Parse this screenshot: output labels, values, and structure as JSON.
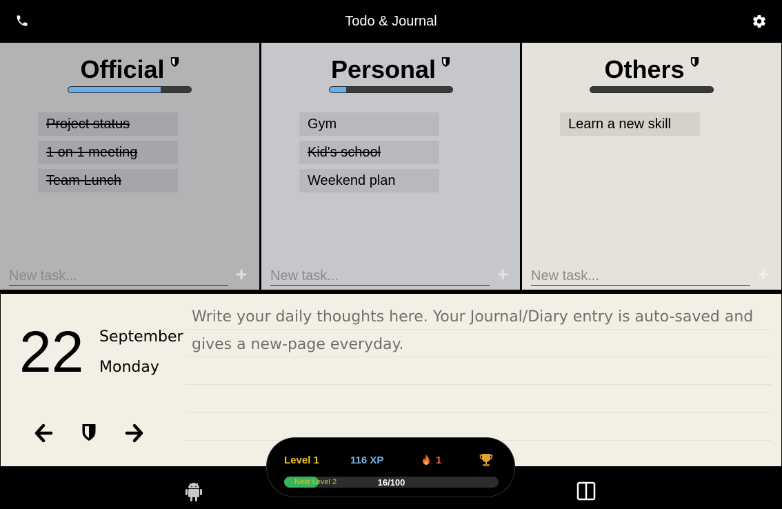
{
  "header": {
    "title": "Todo & Journal",
    "left_icon": "phone-icon",
    "right_icon": "gear-icon"
  },
  "columns": [
    {
      "title": "Official",
      "progress_percent": 75,
      "tasks": [
        {
          "label": "Project status",
          "done": true
        },
        {
          "label": "1 on 1 meeting",
          "done": true
        },
        {
          "label": "Team Lunch",
          "done": true
        }
      ],
      "new_task_placeholder": "New task...",
      "add_icon": "plus-icon"
    },
    {
      "title": "Personal",
      "progress_percent": 14,
      "tasks": [
        {
          "label": "Gym",
          "done": false
        },
        {
          "label": "Kid's school",
          "done": true
        },
        {
          "label": "Weekend plan",
          "done": false
        }
      ],
      "new_task_placeholder": "New task...",
      "add_icon": "plus-icon"
    },
    {
      "title": "Others",
      "progress_percent": 0,
      "tasks": [
        {
          "label": "Learn a new skill",
          "done": false
        }
      ],
      "new_task_placeholder": "New task...",
      "add_icon": "plus-icon"
    }
  ],
  "journal": {
    "day": "22",
    "month": "September",
    "weekday": "Monday",
    "entry_placeholder": "Write your daily thoughts here. Your Journal/Diary entry is auto-saved and gives a new-page everyday.",
    "nav_icons": [
      "arrow-left-icon",
      "shield-icon",
      "arrow-right-icon"
    ]
  },
  "gamification": {
    "level": "Level 1",
    "xp": "116 XP",
    "streak": "1",
    "next_level": "Next Level 2",
    "progress_text": "16/100",
    "progress_percent": 16,
    "colors": {
      "level": "#f5c518",
      "xp": "#78b4e8",
      "streak": "#f06a30",
      "bar": "#3ab35a"
    }
  },
  "bottom_bar": {
    "icons": [
      "android-icon",
      "split-panel-icon"
    ]
  },
  "colors": {
    "official_bg": "#b3b3b6",
    "personal_bg": "#c6c7cb",
    "others_bg": "#e4e2db",
    "journal_bg": "#f2f0e4",
    "progress_fill": "#6aaef0"
  }
}
